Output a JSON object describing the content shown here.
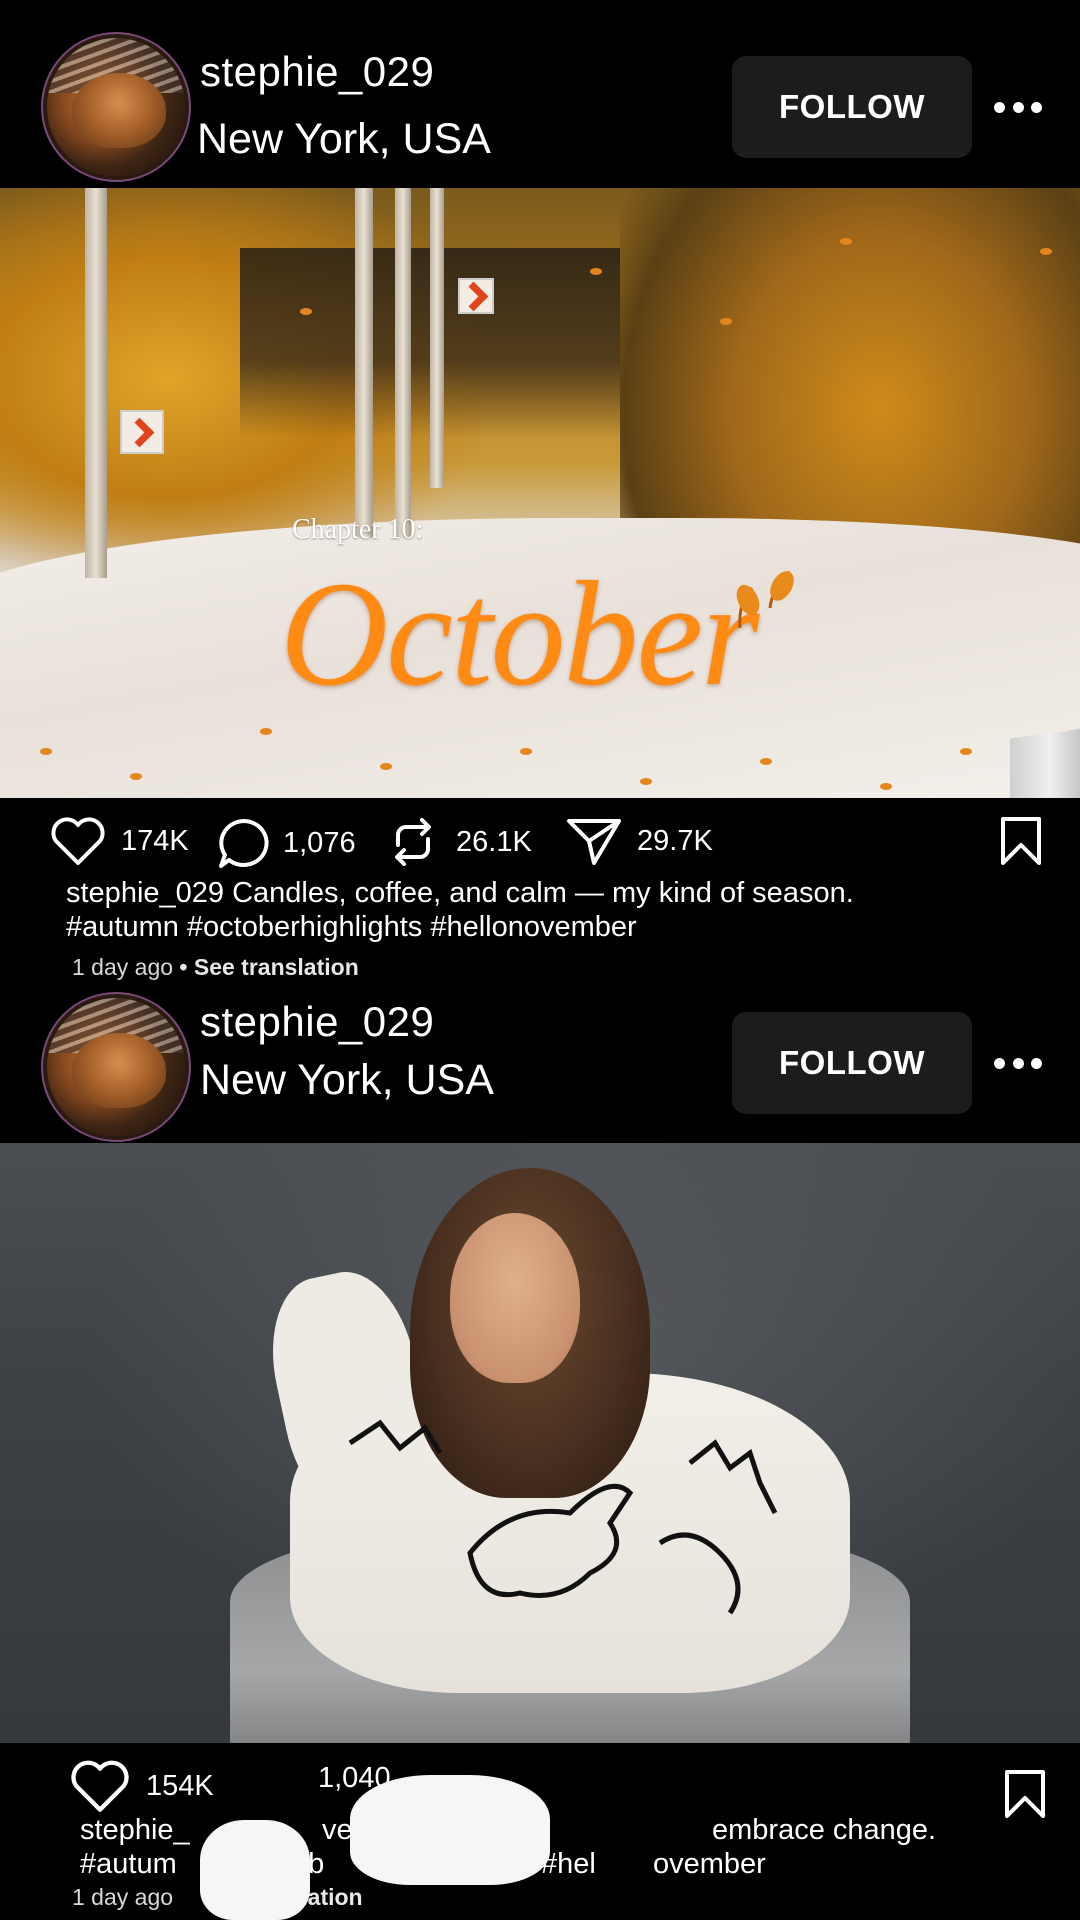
{
  "colors": {
    "background": "#000000",
    "follow_bg": "#1c1c1c",
    "accent_orange": "#ff8a14"
  },
  "posts": [
    {
      "username": "stephie_029",
      "location": "New York, USA",
      "follow_label": "FOLLOW",
      "image_text": {
        "chapter": "Chapter 10:",
        "title": "October"
      },
      "likes": "174K",
      "comments": "1,076",
      "reposts": "26.1K",
      "shares": "29.7K",
      "caption_line1": "stephie_029 Candles, coffee, and calm — my kind of season.",
      "caption_line2": "#autumn #octoberhighlights #hellonovember",
      "time": "1 day ago",
      "see_translation": "• See translation"
    },
    {
      "username": "stephie_029",
      "location": "New York, USA",
      "follow_label": "FOLLOW",
      "likes": "154K",
      "comments": "1,040",
      "caption_line1": "stephie_",
      "caption_line1_b": "ve",
      "caption_line1_c": "embrace change.",
      "caption_line2": "#autum",
      "caption_line2_b": "ob",
      "caption_line2_c": "#hel",
      "caption_line2_d": "ovember",
      "time": "1 day ago",
      "see_translation_partial": "nslation"
    }
  ]
}
